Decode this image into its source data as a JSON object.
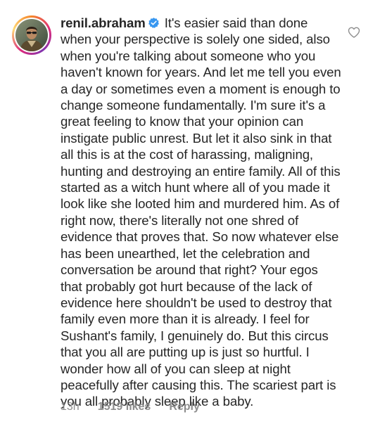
{
  "comment": {
    "username": "renil.abraham",
    "verified": true,
    "text": "It's easier said than done when your perspective is solely one sided, also when you're talking about someone who you haven't known for years. And let me tell you even a day or sometimes even a moment is enough to change someone fundamentally. I'm sure it's a great feeling to know that your opinion can instigate public unrest. But let it also sink in that all this is at the cost of harassing, maligning, hunting and destroying an entire family. All of this started as a witch hunt where all of you made it look like she looted him and murdered him. As of right now, there's literally not one shred of evidence that proves that. So now whatever else has been unearthed, let the celebration and conversation be around that right? Your egos that probably got hurt because of the lack of evidence here shouldn't be used to destroy that family even more than it is already. I feel for Sushant's family, I genuinely do. But this circus that you all are putting up is just so hurtful. I wonder how all of you can sleep at night peacefully after causing this. The scariest part is you all probably sleep like a baby.",
    "time": "13h",
    "likes": "1519 likes",
    "reply_label": "Reply"
  },
  "icons": {
    "verified": "verified-badge-icon",
    "like": "heart-outline-icon"
  },
  "colors": {
    "verified_blue": "#3897f0",
    "meta_gray": "#8e8e8e",
    "text": "#262626"
  }
}
